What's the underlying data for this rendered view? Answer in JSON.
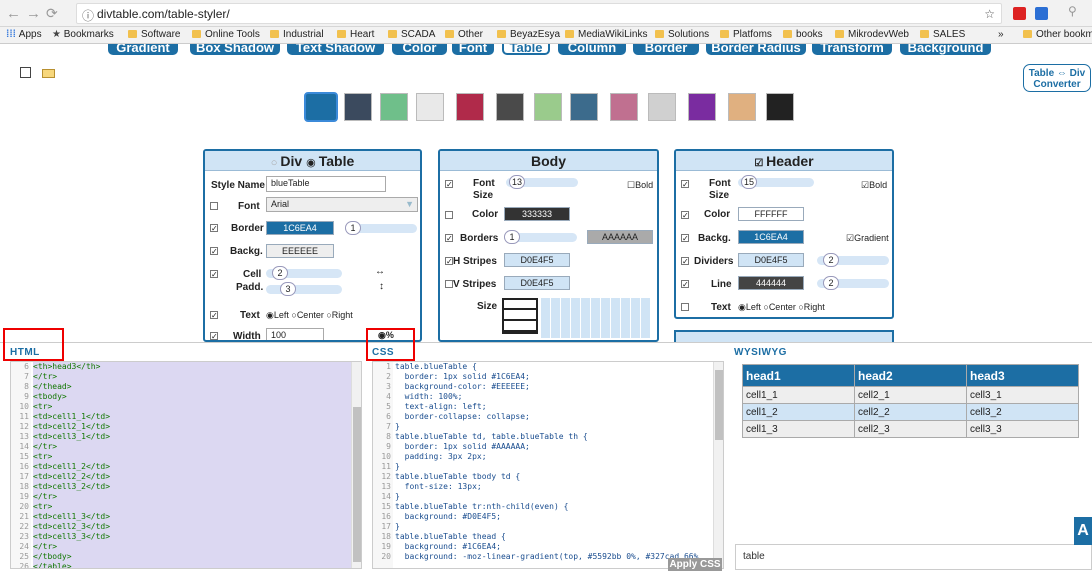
{
  "browser": {
    "url": "divtable.com/table-styler/",
    "info_icon": "info-icon",
    "star_icon": "star-icon"
  },
  "bookmarks": {
    "apps": "Apps",
    "items": [
      "Bookmarks",
      "Software",
      "Online Tools",
      "Industrial",
      "Heart",
      "SCADA",
      "Other",
      "BeyazEsya",
      "MediaWikiLinks",
      "Solutions",
      "Platfoms",
      "books",
      "MikrodevWeb",
      "SALES"
    ],
    "more": "»",
    "other": "Other bookm"
  },
  "top_tabs": [
    "Gradient",
    "Box Shadow",
    "Text Shadow",
    "Color",
    "Font",
    "Table",
    "Column",
    "Border",
    "Border Radius",
    "Transform",
    "Background"
  ],
  "converter": {
    "line1": "Table ⇔ Div",
    "line2": "Converter"
  },
  "panel_table": {
    "div_label": "Div",
    "table_label": "Table",
    "style_name_label": "Style Name",
    "style_name_value": "blueTable",
    "font_label": "Font",
    "font_value": "Arial",
    "border_label": "Border",
    "border_color": "1C6EA4",
    "border_width": "1",
    "backg_label": "Backg.",
    "backg_color": "EEEEEE",
    "cell_label": "Cell",
    "padd_label": "Padd.",
    "cell_h": "2",
    "cell_v": "3",
    "text_label": "Text",
    "align_left": "Left",
    "align_center": "Center",
    "align_right": "Right",
    "width_label": "Width",
    "width_value": "100",
    "pct": "%"
  },
  "panel_body": {
    "title": "Body",
    "font_label": "Font",
    "size_label": "Size",
    "font_size": "13",
    "bold_label": "Bold",
    "color_label": "Color",
    "color_value": "333333",
    "borders_label": "Borders",
    "borders_width": "1",
    "borders_color": "AAAAAA",
    "hstripes_label": "H Stripes",
    "hstripes_color": "D0E4F5",
    "vstripes_label": "V Stripes",
    "vstripes_color": "D0E4F5",
    "grid_size_label": "Size"
  },
  "panel_header": {
    "title": "Header",
    "font_label": "Font",
    "size_label": "Size",
    "font_size": "15",
    "bold_label": "Bold",
    "color_label": "Color",
    "color_value": "FFFFFF",
    "backg_label": "Backg.",
    "backg_color": "1C6EA4",
    "gradient_label": "Gradient",
    "dividers_label": "Dividers",
    "dividers_color": "D0E4F5",
    "dividers_width": "2",
    "line_label": "Line",
    "line_color": "444444",
    "line_width": "2",
    "text_label": "Text",
    "align_left": "Left",
    "align_center": "Center",
    "align_right": "Right"
  },
  "html_panel": {
    "title": "HTML",
    "lines": [
      {
        "n": "6",
        "t": "<th>head3</th>"
      },
      {
        "n": "7",
        "t": "</tr>"
      },
      {
        "n": "8",
        "t": "</thead>"
      },
      {
        "n": "9",
        "t": "<tbody>"
      },
      {
        "n": "10",
        "t": "<tr>"
      },
      {
        "n": "11",
        "t": "<td>cell1_1</td>"
      },
      {
        "n": "12",
        "t": "<td>cell2_1</td>"
      },
      {
        "n": "13",
        "t": "<td>cell3_1</td>"
      },
      {
        "n": "14",
        "t": "</tr>"
      },
      {
        "n": "15",
        "t": "<tr>"
      },
      {
        "n": "16",
        "t": "<td>cell1_2</td>"
      },
      {
        "n": "17",
        "t": "<td>cell2_2</td>"
      },
      {
        "n": "18",
        "t": "<td>cell3_2</td>"
      },
      {
        "n": "19",
        "t": "</tr>"
      },
      {
        "n": "20",
        "t": "<tr>"
      },
      {
        "n": "21",
        "t": "<td>cell1_3</td>"
      },
      {
        "n": "22",
        "t": "<td>cell2_3</td>"
      },
      {
        "n": "23",
        "t": "<td>cell3_3</td>"
      },
      {
        "n": "24",
        "t": "</tr>"
      },
      {
        "n": "25",
        "t": "</tbody>"
      },
      {
        "n": "26",
        "t": "</table>"
      }
    ]
  },
  "css_panel": {
    "title": "CSS",
    "apply": "Apply CSS",
    "lines": [
      {
        "n": "1",
        "t": "table.blueTable {"
      },
      {
        "n": "2",
        "t": "  border: 1px solid #1C6EA4;"
      },
      {
        "n": "3",
        "t": "  background-color: #EEEEEE;"
      },
      {
        "n": "4",
        "t": "  width: 100%;"
      },
      {
        "n": "5",
        "t": "  text-align: left;"
      },
      {
        "n": "6",
        "t": "  border-collapse: collapse;"
      },
      {
        "n": "7",
        "t": "}"
      },
      {
        "n": "8",
        "t": "table.blueTable td, table.blueTable th {"
      },
      {
        "n": "9",
        "t": "  border: 1px solid #AAAAAA;"
      },
      {
        "n": "10",
        "t": "  padding: 3px 2px;"
      },
      {
        "n": "11",
        "t": "}"
      },
      {
        "n": "12",
        "t": "table.blueTable tbody td {"
      },
      {
        "n": "13",
        "t": "  font-size: 13px;"
      },
      {
        "n": "14",
        "t": "}"
      },
      {
        "n": "15",
        "t": "table.blueTable tr:nth-child(even) {"
      },
      {
        "n": "16",
        "t": "  background: #D0E4F5;"
      },
      {
        "n": "17",
        "t": "}"
      },
      {
        "n": "18",
        "t": "table.blueTable thead {"
      },
      {
        "n": "19",
        "t": "  background: #1C6EA4;"
      },
      {
        "n": "20",
        "t": "  background: -moz-linear-gradient(top, #5592bb 0%, #327cad 66%"
      }
    ]
  },
  "wysiwyg": {
    "title": "WYSIWYG",
    "headers": [
      "head1",
      "head2",
      "head3"
    ],
    "rows": [
      [
        "cell1_1",
        "cell2_1",
        "cell3_1"
      ],
      [
        "cell1_2",
        "cell2_2",
        "cell3_2"
      ],
      [
        "cell1_3",
        "cell2_3",
        "cell3_3"
      ]
    ],
    "footer": "table"
  },
  "colors": {
    "accent": "#1C6EA4",
    "stripe": "#D0E4F5",
    "highlight": "#E00000"
  }
}
